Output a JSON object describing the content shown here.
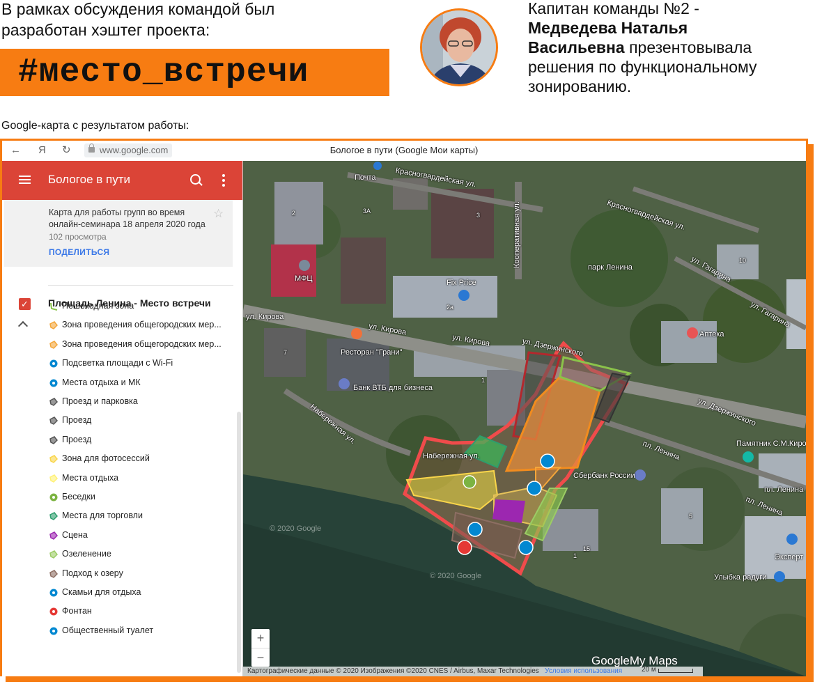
{
  "intro": {
    "line1": "В рамках обсуждения командой был",
    "line2": "разработан хэштег проекта:"
  },
  "hashtag": "#место_встречи",
  "captain": {
    "line1": "Капитан команды №2 -",
    "name1": "Медведева Наталья",
    "name2": "Васильевна",
    "rest1": " презентовывала",
    "rest2": "решения по функциональному",
    "rest3": "зонированию."
  },
  "map_caption": "Google-карта с результатом работы:",
  "browser": {
    "url": "www.google.com",
    "tab_title": "Бологое в пути (Google Мои карты)",
    "back_icon": "arrow-left-icon",
    "yandex_icon": "Я",
    "reload_icon": "reload-icon"
  },
  "sidebar": {
    "title": "Бологое в пути",
    "description": "Карта для работы групп во время онлайн-семинара 18 апреля 2020 года",
    "views": "102 просмотра",
    "share": "ПОДЕЛИТЬСЯ",
    "layer_title": "Площадь Ленина - Место встречи",
    "accent_color": "#db4437",
    "items": [
      {
        "label": "Пешеходная зона",
        "color": "#8bc34a",
        "icon": "line-icon"
      },
      {
        "label": "Зона проведения общегородских мер...",
        "color": "#f4a63a",
        "icon": "polygon-icon"
      },
      {
        "label": "Зона проведения общегородских мер...",
        "color": "#f4a63a",
        "icon": "polygon-icon"
      },
      {
        "label": "Подсветка площади с Wi-Fi",
        "color": "#0288d1",
        "icon": "wifi-icon"
      },
      {
        "label": "Места отдыха и МК",
        "color": "#0288d1",
        "icon": "rest-icon"
      },
      {
        "label": "Проезд и парковка",
        "color": "#555555",
        "icon": "polygon-icon"
      },
      {
        "label": "Проезд",
        "color": "#555555",
        "icon": "polygon-icon"
      },
      {
        "label": "Проезд",
        "color": "#555555",
        "icon": "polygon-icon"
      },
      {
        "label": "Зона для фотосессий",
        "color": "#f9d54a",
        "icon": "polygon-icon"
      },
      {
        "label": "Места отдыха",
        "color": "#fff176",
        "icon": "polygon-icon"
      },
      {
        "label": "Беседки",
        "color": "#7cb342",
        "icon": "gazebo-icon"
      },
      {
        "label": "Места для торговли",
        "color": "#2e9e6e",
        "icon": "polygon-icon"
      },
      {
        "label": "Сцена",
        "color": "#9c27b0",
        "icon": "polygon-icon"
      },
      {
        "label": "Озеленение",
        "color": "#9ccc65",
        "icon": "polygon-icon"
      },
      {
        "label": "Подход к озеру",
        "color": "#8d6e63",
        "icon": "polygon-icon"
      },
      {
        "label": "Скамьи для отдыха",
        "color": "#0288d1",
        "icon": "bench-icon"
      },
      {
        "label": "Фонтан",
        "color": "#e53935",
        "icon": "fountain-icon"
      },
      {
        "label": "Общественный туалет",
        "color": "#0288d1",
        "icon": "toilet-icon"
      }
    ]
  },
  "map": {
    "labels": {
      "pochta": "Почта",
      "krasnogv1": "Красногвардейская ул.",
      "krasnogv2": "Красногвардейская ул.",
      "kooperat": "Кооперативная ул.",
      "park": "парк Ленина",
      "gagarina1": "ул. Гагарина",
      "gagarina2": "ул. Гагарина",
      "mfc": "МФЦ",
      "fixprice": "Fix Price",
      "kirova1": "ул. Кирова",
      "kirova2": "ул. Кирова",
      "kirova3": "ул. Кирова",
      "apteka": "Аптека",
      "dzerzh1": "ул. Дзержинского",
      "dzerzh2": "ул. Дзержинского",
      "restoran": "Ресторан \"Грани\"",
      "vtb": "Банк ВТБ для бизнеса",
      "naberezh1": "Набережная ул.",
      "naberezh2": "Набережная ул.",
      "pamyatnik": "Памятник С.М.Киров",
      "lenina1": "пл. Ленина",
      "lenina2": "пл. Ленина",
      "lenina3": "пл. Ленина",
      "sberbank": "Сбербанк России",
      "ekspert": "Эксперт",
      "ulybka": "Улыбка радуги",
      "copyright1": "© 2020 Google",
      "copyright2": "© 2020 Google",
      "naberezh_road": "Набережная ул."
    },
    "house_numbers": [
      "2",
      "3А",
      "3",
      "10",
      "2а",
      "7",
      "1",
      "5",
      "15",
      "1"
    ],
    "attribution": "Картографические данные © 2020 Изображения ©2020 CNES / Airbus, Maxar Technologies",
    "terms": "Условия использования",
    "scale": "20 м",
    "logo_google": "Google",
    "logo_mymaps": "My Maps",
    "zoom_in": "+",
    "zoom_out": "−"
  }
}
